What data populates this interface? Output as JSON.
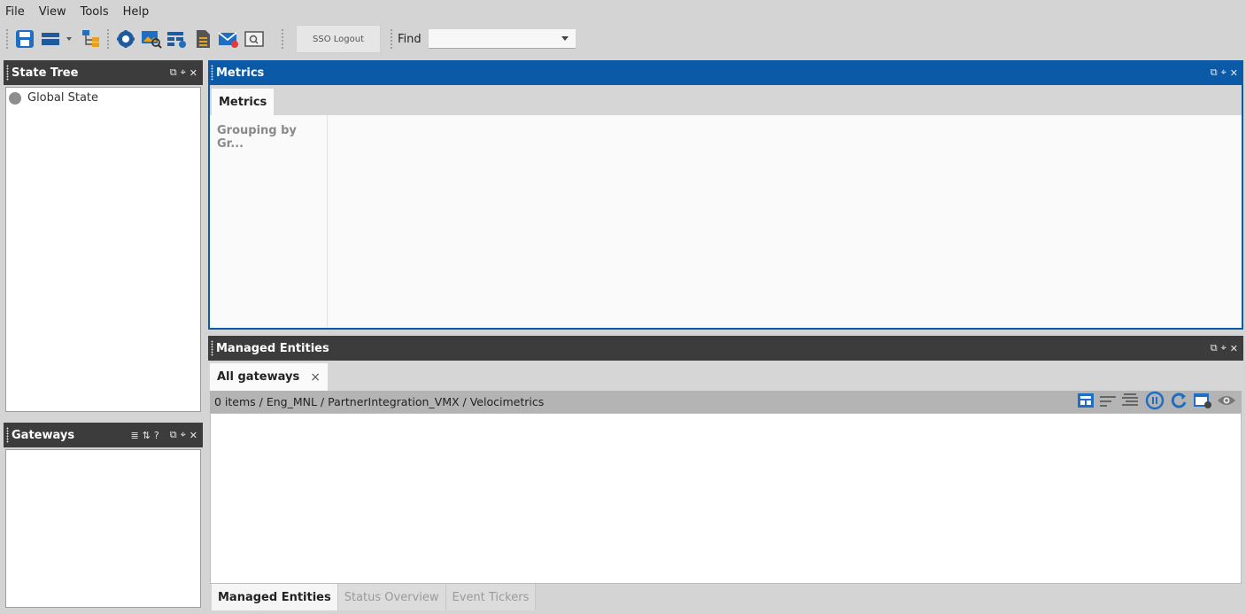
{
  "menu": [
    "File",
    "View",
    "Tools",
    "Help"
  ],
  "toolbar": {
    "icons": [
      "save-icon",
      "layout-icon",
      "hierarchy-icon",
      "settings-icon",
      "image-search-icon",
      "grid-settings-icon",
      "document-icon",
      "mail-icon",
      "screen-search-icon"
    ],
    "sso_label": "SSO Logout",
    "find_label": "Find",
    "find_value": ""
  },
  "state_tree": {
    "title": "State Tree",
    "items": [
      {
        "label": "Global State",
        "status": "grey"
      }
    ]
  },
  "gateways": {
    "title": "Gateways"
  },
  "metrics": {
    "title": "Metrics",
    "tab": "Metrics",
    "grouping": "Grouping by Gr..."
  },
  "managed_entities": {
    "title": "Managed Entities",
    "tab": "All gateways",
    "tab_close": "×",
    "info": "0 items  / Eng_MNL / PartnerIntegration_VMX / Velocimetrics",
    "icons": [
      "table-view-icon",
      "sort-icon",
      "tree-sort-icon",
      "pause-icon",
      "refresh-icon",
      "export-icon",
      "eye-icon"
    ]
  },
  "bottom_tabs": [
    "Managed Entities",
    "Status Overview",
    "Event Tickers"
  ],
  "colors": {
    "accent_blue": "#0b5aa8",
    "header_dark": "#3c3c3c",
    "icon_blue": "#1e6fc4",
    "icon_orange": "#e8a11a"
  }
}
